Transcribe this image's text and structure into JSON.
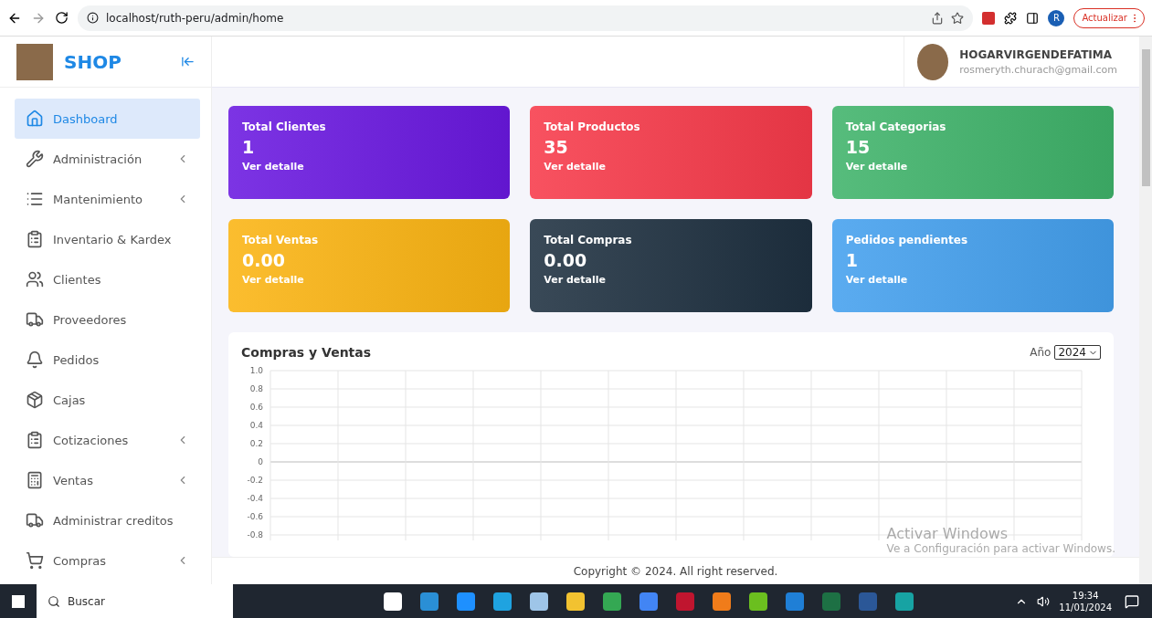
{
  "browser": {
    "url": "localhost/ruth-peru/admin/home",
    "profile_initial": "R",
    "update_button": "Actualizar"
  },
  "sidebar": {
    "brand": "SHOP",
    "items": [
      {
        "label": "Dashboard",
        "selected": true,
        "submenu": false
      },
      {
        "label": "Administración",
        "selected": false,
        "submenu": true
      },
      {
        "label": "Mantenimiento",
        "selected": false,
        "submenu": true
      },
      {
        "label": "Inventario & Kardex",
        "selected": false,
        "submenu": false
      },
      {
        "label": "Clientes",
        "selected": false,
        "submenu": false
      },
      {
        "label": "Proveedores",
        "selected": false,
        "submenu": false
      },
      {
        "label": "Pedidos",
        "selected": false,
        "submenu": false
      },
      {
        "label": "Cajas",
        "selected": false,
        "submenu": false
      },
      {
        "label": "Cotizaciones",
        "selected": false,
        "submenu": true
      },
      {
        "label": "Ventas",
        "selected": false,
        "submenu": true
      },
      {
        "label": "Administrar creditos",
        "selected": false,
        "submenu": false
      },
      {
        "label": "Compras",
        "selected": false,
        "submenu": true
      }
    ]
  },
  "user": {
    "name": "HOGARVIRGENDEFATIMA",
    "email": "rosmeryth.churach@gmail.com"
  },
  "cards": [
    {
      "title": "Total Clientes",
      "value": "1",
      "link": "Ver detalle",
      "color": "#6a18e0"
    },
    {
      "title": "Total Productos",
      "value": "35",
      "link": "Ver detalle",
      "color": "#f73a4a"
    },
    {
      "title": "Total Categorias",
      "value": "15",
      "link": "Ver detalle",
      "color": "#3fb36a"
    },
    {
      "title": "Total Ventas",
      "value": "0.00",
      "link": "Ver detalle",
      "color": "#fbb412"
    },
    {
      "title": "Total Compras",
      "value": "0.00",
      "link": "Ver detalle",
      "color": "#1e3040"
    },
    {
      "title": "Pedidos pendientes",
      "value": "1",
      "link": "Ver detalle",
      "color": "#44a0ee"
    }
  ],
  "chart_panel": {
    "title": "Compras y Ventas",
    "year_label": "Año",
    "year": "2024",
    "axis_labels": [
      "1.0",
      "0.8",
      "0.6",
      "0.4",
      "0.2",
      "0",
      "-0.2",
      "-0.4",
      "-0.6",
      "-0.8"
    ]
  },
  "footer": "Copyright © 2024. All right reserved.",
  "activation": {
    "title": "Activar Windows",
    "message": "Ve a Configuración para activar Windows."
  },
  "taskbar": {
    "search": "Buscar",
    "time": "19:34",
    "date": "11/01/2024"
  }
}
